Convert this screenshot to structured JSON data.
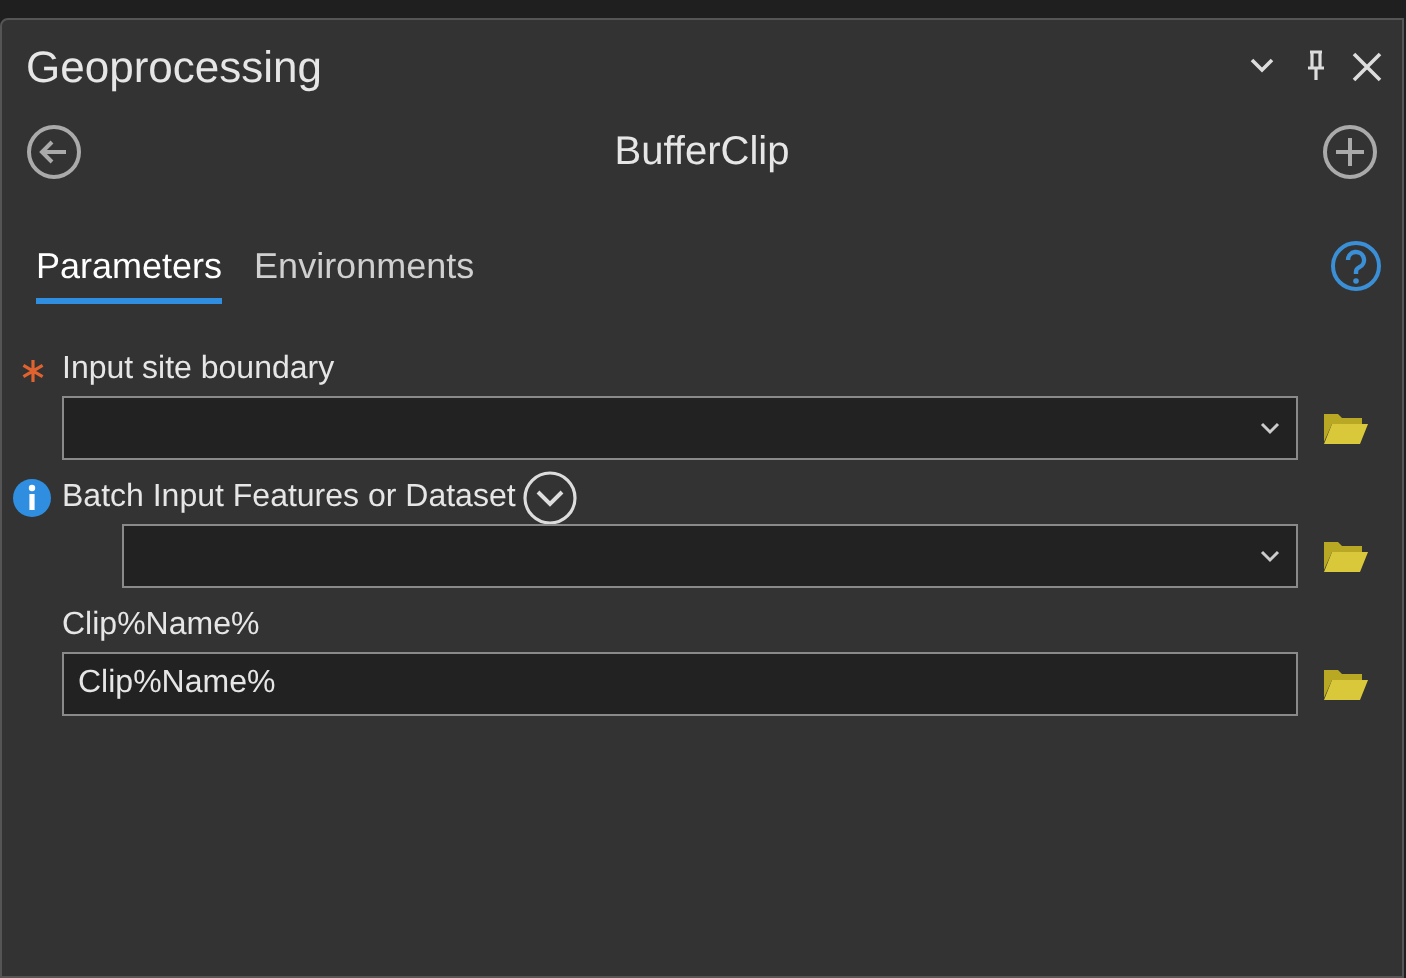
{
  "pane": {
    "title": "Geoprocessing"
  },
  "tool": {
    "name": "BufferClip"
  },
  "tabs": [
    {
      "label": "Parameters",
      "selected": true
    },
    {
      "label": "Environments",
      "selected": false
    }
  ],
  "parameters": [
    {
      "label": "Input site boundary",
      "kind": "dropdown",
      "required": true,
      "info": false,
      "expander": false,
      "indented": false
    },
    {
      "label": "Batch Input Features or Dataset",
      "kind": "dropdown",
      "required": false,
      "info": true,
      "expander": true,
      "indented": true
    },
    {
      "label": "Clip%Name%",
      "kind": "text",
      "value": "Clip%Name%",
      "required": false,
      "info": false,
      "expander": false,
      "indented": false
    }
  ]
}
